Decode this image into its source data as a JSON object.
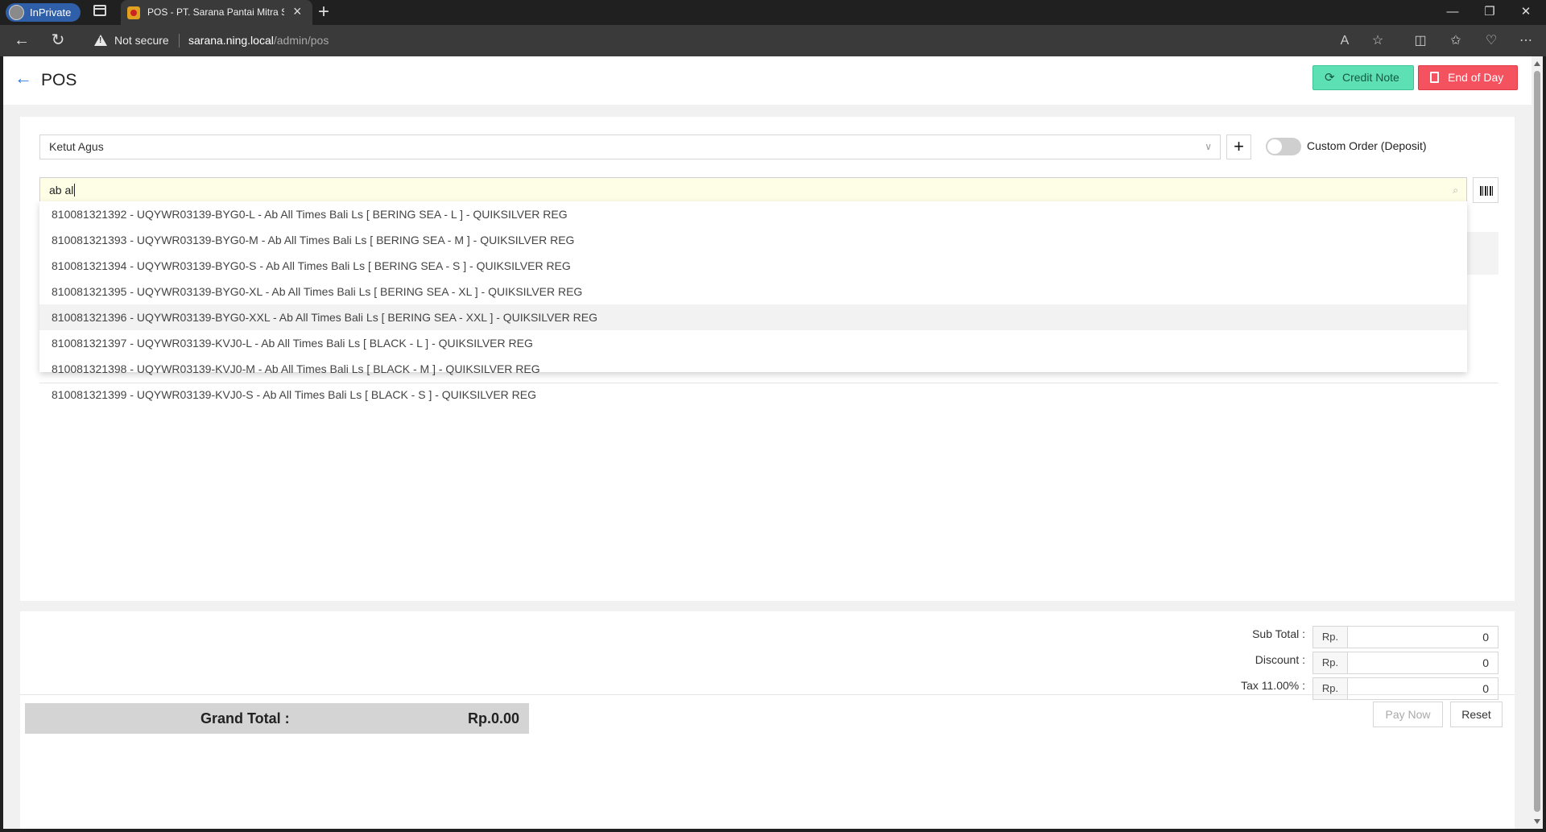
{
  "browser": {
    "inprivate_label": "InPrivate",
    "tab_title": "POS - PT. Sarana Pantai Mitra Se",
    "security_label": "Not secure",
    "url_host": "sarana.ning.local",
    "url_path": "/admin/pos"
  },
  "header": {
    "title": "POS",
    "credit_note_label": "Credit Note",
    "end_of_day_label": "End of Day",
    "accent_credit": "#5ce0b4",
    "accent_eod": "#f4525e"
  },
  "customer": {
    "selected": "Ketut Agus",
    "add_label": "+",
    "custom_order_label": "Custom Order (Deposit)"
  },
  "search": {
    "value": "ab al",
    "suggestions": [
      "810081321392 - UQYWR03139-BYG0-L - Ab All Times Bali Ls [ BERING SEA - L ] - QUIKSILVER REG",
      "810081321393 - UQYWR03139-BYG0-M - Ab All Times Bali Ls [ BERING SEA - M ] - QUIKSILVER REG",
      "810081321394 - UQYWR03139-BYG0-S - Ab All Times Bali Ls [ BERING SEA - S ] - QUIKSILVER REG",
      "810081321395 - UQYWR03139-BYG0-XL - Ab All Times Bali Ls [ BERING SEA - XL ] - QUIKSILVER REG",
      "810081321396 - UQYWR03139-BYG0-XXL - Ab All Times Bali Ls [ BERING SEA - XXL ] - QUIKSILVER REG",
      "810081321397 - UQYWR03139-KVJ0-L - Ab All Times Bali Ls [ BLACK - L ] - QUIKSILVER REG",
      "810081321398 - UQYWR03139-KVJ0-M - Ab All Times Bali Ls [ BLACK - M ] - QUIKSILVER REG",
      "810081321399 - UQYWR03139-KVJ0-S - Ab All Times Bali Ls [ BLACK - S ] - QUIKSILVER REG"
    ]
  },
  "totals": {
    "subtotal_label": "Sub Total :",
    "discount_label": "Discount :",
    "tax_label": "Tax 11.00% :",
    "currency": "Rp.",
    "subtotal_value": "0",
    "discount_value": "0",
    "tax_value": "0",
    "grand_total_label": "Grand Total :",
    "grand_total_value": "Rp.0.00",
    "pay_now_label": "Pay Now",
    "reset_label": "Reset"
  }
}
